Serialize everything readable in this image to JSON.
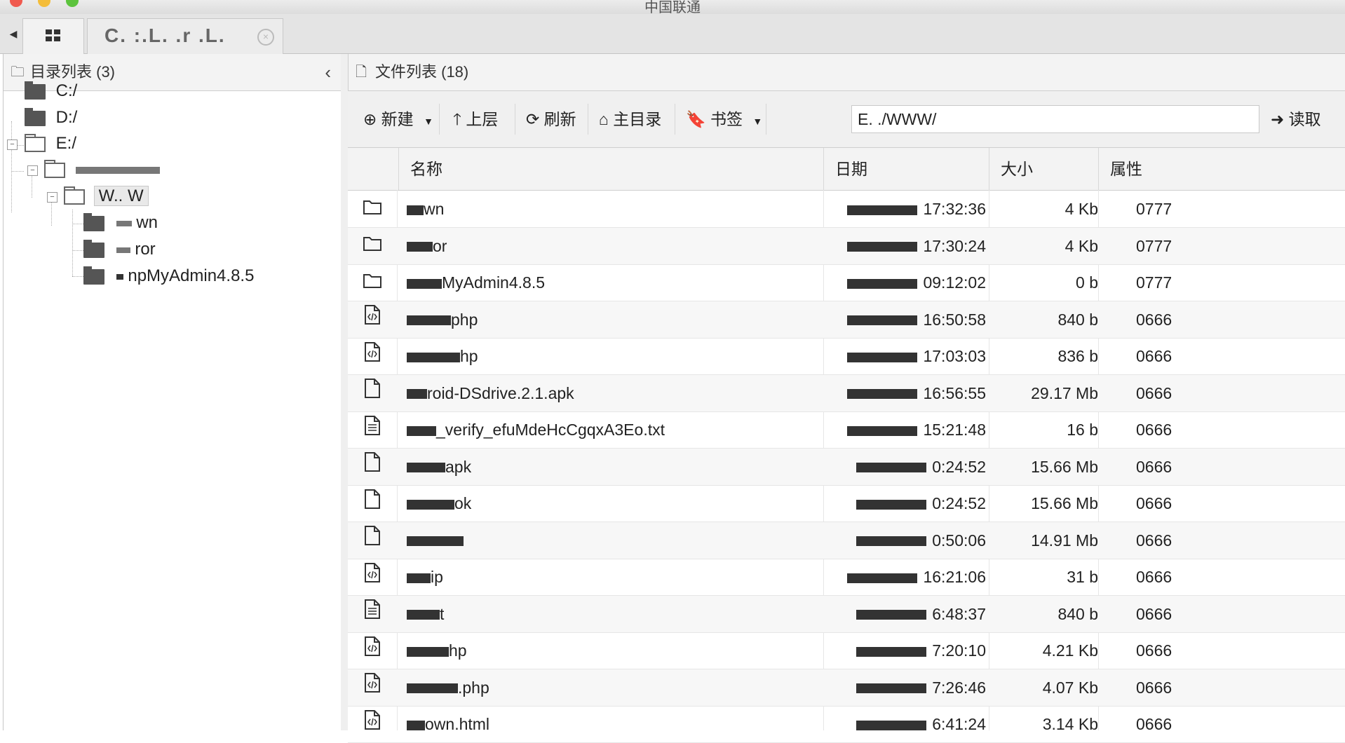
{
  "window": {
    "title": "中国联通"
  },
  "tabs": {
    "home_icon": "grid-icon",
    "site_label": "C. :.L. .r .L.",
    "close_symbol": "×"
  },
  "left_panel": {
    "title": "目录列表 (3)",
    "collapse_symbol": "‹",
    "tree": [
      {
        "label": "C:/",
        "level": 0,
        "type": "drive"
      },
      {
        "label": "D:/",
        "level": 0,
        "type": "drive"
      },
      {
        "label": "E:/",
        "level": 0,
        "type": "drive-open"
      },
      {
        "label": "",
        "level": 1,
        "type": "folder-open"
      },
      {
        "label": "W.. W",
        "level": 2,
        "type": "folder-open",
        "selected": true
      },
      {
        "label": "wn",
        "level": 3,
        "type": "folder"
      },
      {
        "label": "ror",
        "level": 3,
        "type": "folder"
      },
      {
        "label": "npMyAdmin4.8.5",
        "level": 3,
        "type": "folder"
      }
    ]
  },
  "right_panel": {
    "title": "文件列表 (18)",
    "toolbar": {
      "new_label": "新建",
      "up_label": "上层",
      "refresh_label": "刷新",
      "home_label": "主目录",
      "bookmark_label": "书签",
      "read_label": "读取",
      "path_value": "E. ./WWW/"
    },
    "columns": {
      "name": "名称",
      "date": "日期",
      "size": "大小",
      "attr": "属性"
    },
    "files": [
      {
        "icon": "folder-icon",
        "name": "wn",
        "date": "17:32:36",
        "size": "4 Kb",
        "attr": "0777"
      },
      {
        "icon": "folder-icon",
        "name": "or",
        "date": "17:30:24",
        "size": "4 Kb",
        "attr": "0777"
      },
      {
        "icon": "folder-icon",
        "name": "MyAdmin4.8.5",
        "date": "09:12:02",
        "size": "0 b",
        "attr": "0777"
      },
      {
        "icon": "code-file-icon",
        "name": "php",
        "date": "16:50:58",
        "size": "840 b",
        "attr": "0666"
      },
      {
        "icon": "code-file-icon",
        "name": "hp",
        "date": "17:03:03",
        "size": "836 b",
        "attr": "0666"
      },
      {
        "icon": "file-icon",
        "name": "roid-DSdrive.2.1.apk",
        "date": "16:56:55",
        "size": "29.17 Mb",
        "attr": "0666"
      },
      {
        "icon": "text-file-icon",
        "name": "_verify_efuMdeHcCgqxA3Eo.txt",
        "date": "15:21:48",
        "size": "16 b",
        "attr": "0666"
      },
      {
        "icon": "file-icon",
        "name": "apk",
        "date": "0:24:52",
        "size": "15.66 Mb",
        "attr": "0666"
      },
      {
        "icon": "file-icon",
        "name": "ok",
        "date": "0:24:52",
        "size": "15.66 Mb",
        "attr": "0666"
      },
      {
        "icon": "file-icon",
        "name": "",
        "date": "0:50:06",
        "size": "14.91 Mb",
        "attr": "0666"
      },
      {
        "icon": "code-file-icon",
        "name": "ip",
        "date": "16:21:06",
        "size": "31 b",
        "attr": "0666"
      },
      {
        "icon": "text-file-icon",
        "name": "t",
        "date": "6:48:37",
        "size": "840 b",
        "attr": "0666"
      },
      {
        "icon": "code-file-icon",
        "name": "hp",
        "date": "7:20:10",
        "size": "4.21 Kb",
        "attr": "0666"
      },
      {
        "icon": "code-file-icon",
        "name": ".php",
        "date": "7:26:46",
        "size": "4.07 Kb",
        "attr": "0666"
      },
      {
        "icon": "code-file-icon",
        "name": "own.html",
        "date": "6:41:24",
        "size": "3.14 Kb",
        "attr": "0666"
      }
    ]
  }
}
